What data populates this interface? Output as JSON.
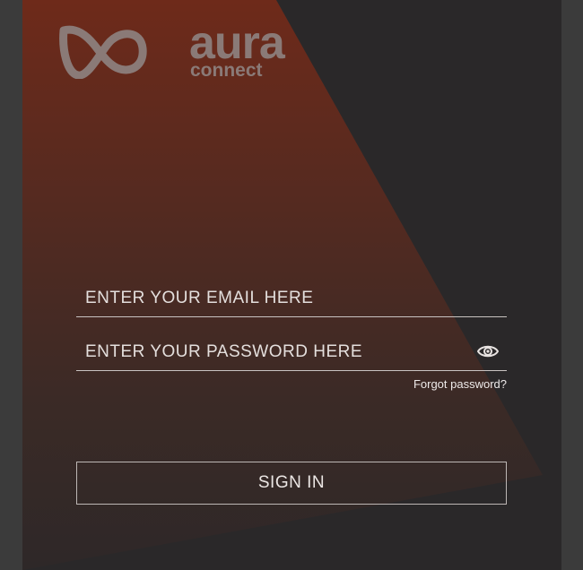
{
  "logo": {
    "word": "aura",
    "sub": "connect"
  },
  "form": {
    "email_placeholder": "ENTER YOUR EMAIL HERE",
    "password_placeholder": "ENTER YOUR PASSWORD HERE",
    "forgot_password": "Forgot password?",
    "sign_in": "SIGN IN"
  },
  "icons": {
    "password_toggle": "eye-icon",
    "brand_mark": "infinity-icon"
  },
  "colors": {
    "outer_background": "#3b3b3b",
    "panel_background": "#2a2829",
    "accent_gradient_top": "#6d2a1a",
    "logo": "#8a7a77",
    "text": "#e8e3e1"
  }
}
